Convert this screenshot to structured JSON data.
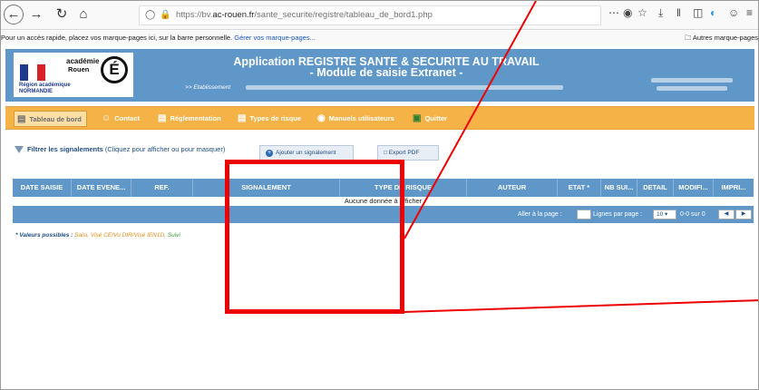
{
  "browser": {
    "url_prefix": "https://bv.",
    "url_domain": "ac-rouen.fr",
    "url_path": "/sante_securite/registre/tableau_de_bord1.php",
    "icons": {
      "back": "arrow-left-icon",
      "forward": "arrow-right-icon",
      "reload": "reload-icon",
      "home": "home-icon",
      "more": "ellipsis-icon",
      "pocket": "pocket-icon",
      "bookmark": "star-icon",
      "download": "download-icon",
      "library": "library-icon",
      "menu": "hamburger-icon"
    }
  },
  "bookmarks": {
    "hint": "Pour un accès rapide, placez vos marque-pages ici, sur la barre personnelle.",
    "manage_link": "Gérer vos marque-pages...",
    "other": "Autres marque-pages"
  },
  "header": {
    "logo_academie": "académie",
    "logo_rouen": "Rouen",
    "logo_letter": "É",
    "logo_region_1": "Région académique",
    "logo_region_2": "NORMANDIE",
    "title_line1": "Application REGISTRE SANTE & SECURITE AU TRAVAIL",
    "title_line2": "- Module de saisie Extranet -",
    "establishment_label": ">> Etablissement"
  },
  "menu": {
    "items": [
      {
        "label": "Tableau de bord",
        "icon": "dashboard-icon"
      },
      {
        "label": "Contact",
        "icon": "users-icon"
      },
      {
        "label": "Réglementation",
        "icon": "book-icon"
      },
      {
        "label": "Types de risque",
        "icon": "document-icon"
      },
      {
        "label": "Manuels utilisateurs",
        "icon": "lightbulb-icon"
      },
      {
        "label": "Quitter",
        "icon": "exit-icon"
      }
    ]
  },
  "filter": {
    "label_bold": "Filtrer les signalements",
    "label_rest": "(Cliquez pour afficher ou pour masquer)",
    "add_button": "Ajouter un signalement",
    "pdf_button": "Export PDF"
  },
  "table": {
    "columns": [
      "DATE SAISIE",
      "DATE EVENE...",
      "REF.",
      "SIGNALEMENT",
      "TYPE DE RISQUE",
      "AUTEUR",
      "ETAT *",
      "NB SUI...",
      "DETAIL",
      "MODIFI...",
      "IMPRI..."
    ],
    "empty_message": "Aucune donnée à afficher",
    "pager": {
      "goto_label": "Aller à la page :",
      "rows_label": "Lignes par page :",
      "rows_value": "10",
      "count": "0-0 sur 0"
    }
  },
  "legend": {
    "label": "* Valeurs possibles :",
    "values_a": "Saisi, Visé CE/Vu DIR/Visé IEN1D,",
    "values_b": "Suivi"
  },
  "colors": {
    "header_blue": "#5f97c8",
    "menu_orange": "#f5b347",
    "annotation_red": "#ee0000"
  }
}
